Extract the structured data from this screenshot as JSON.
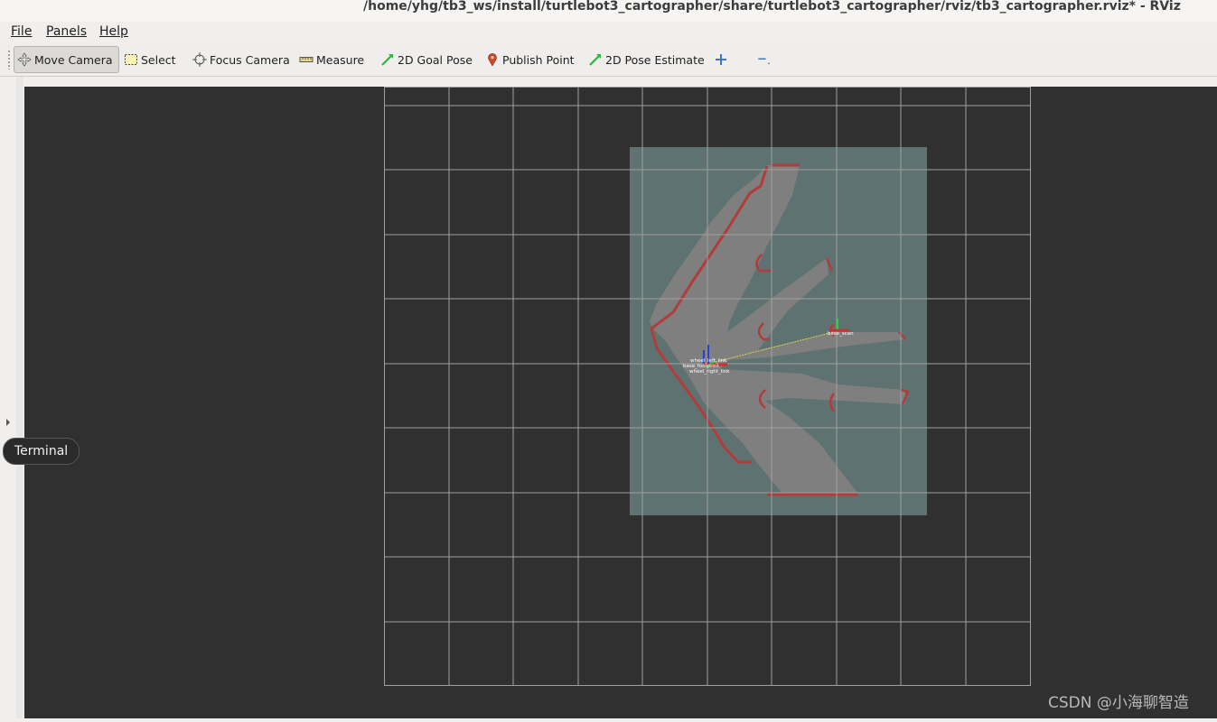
{
  "window": {
    "title": "/home/yhg/tb3_ws/install/turtlebot3_cartographer/share/turtlebot3_cartographer/rviz/tb3_cartographer.rviz* - RViz"
  },
  "menu": {
    "file": "File",
    "panels": "Panels",
    "help": "Help"
  },
  "toolbar": {
    "move_camera": "Move Camera",
    "select": "Select",
    "focus_camera": "Focus Camera",
    "measure": "Measure",
    "goal_pose": "2D Goal Pose",
    "publish_point": "Publish Point",
    "pose_estimate": "2D Pose Estimate",
    "add_icon": "plus-icon",
    "remove_icon": "minus-icon"
  },
  "sidebar": {
    "terminal_tooltip": "Terminal"
  },
  "viewport": {
    "background": "#303030",
    "grid_color": "#a0a0a0",
    "map_free_color": "#7f7f7f",
    "map_unknown_color": "#5e7371",
    "obstacle_color": "#b23b3b",
    "frame_labels": {
      "top": "wheel_left_link",
      "middle": "base_footprint",
      "bottom": "wheel_right_link",
      "scan": "base_scan"
    }
  },
  "watermark": "CSDN @小海聊智造"
}
